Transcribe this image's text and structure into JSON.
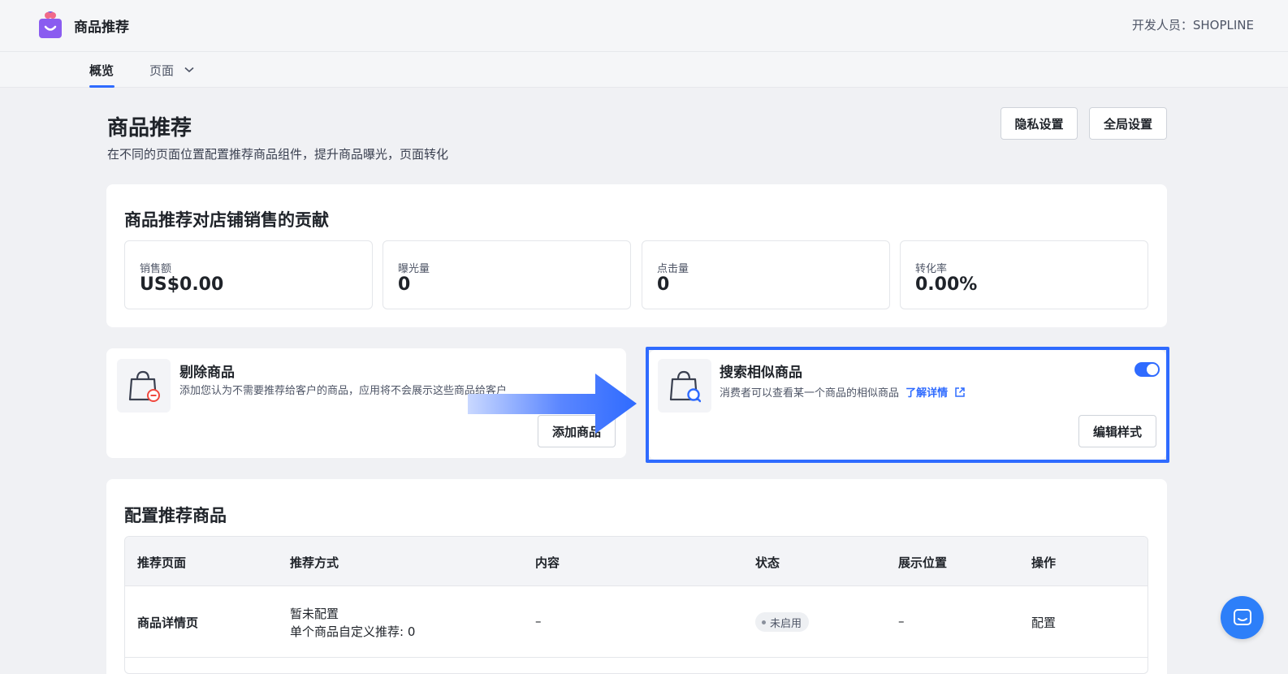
{
  "app": {
    "name": "商品推荐",
    "developer_label": "开发人员：SHOPLINE",
    "logo_icon": "shopping-bag-heart-icon"
  },
  "nav": {
    "tabs": [
      {
        "label": "概览",
        "active": true
      },
      {
        "label": "页面",
        "active": false
      }
    ]
  },
  "header": {
    "title": "商品推荐",
    "subtitle": "在不同的页面位置配置推荐商品组件，提升商品曝光，页面转化",
    "privacy_button": "隐私设置",
    "global_button": "全局设置"
  },
  "contribution": {
    "title": "商品推荐对店铺销售的贡献",
    "stats": [
      {
        "label": "销售额",
        "value": "US$0.00"
      },
      {
        "label": "曝光量",
        "value": "0"
      },
      {
        "label": "点击量",
        "value": "0"
      },
      {
        "label": "转化率",
        "value": "0.00%"
      }
    ]
  },
  "exclude": {
    "title": "剔除商品",
    "description": "添加您认为不需要推荐给客户的商品，应用将不会展示这些商品给客户",
    "button": "添加商品",
    "icon": "bag-remove-icon"
  },
  "similar": {
    "title": "搜索相似商品",
    "description": "消费者可以查看某一个商品的相似商品",
    "link": "了解详情",
    "button": "编辑样式",
    "enabled": true,
    "icon": "bag-search-icon"
  },
  "config": {
    "title": "配置推荐商品",
    "columns": [
      "推荐页面",
      "推荐方式",
      "内容",
      "状态",
      "展示位置",
      "操作"
    ],
    "rows": [
      {
        "page": "商品详情页",
        "method_line1": "暂未配置",
        "method_line2": "单个商品自定义推荐: 0",
        "content": "–",
        "status": "未启用",
        "position": "–",
        "action": "配置"
      }
    ]
  },
  "colors": {
    "accent": "#2f6bff",
    "highlight_border": "#2f6bff",
    "chat": "#2d7ff9"
  }
}
